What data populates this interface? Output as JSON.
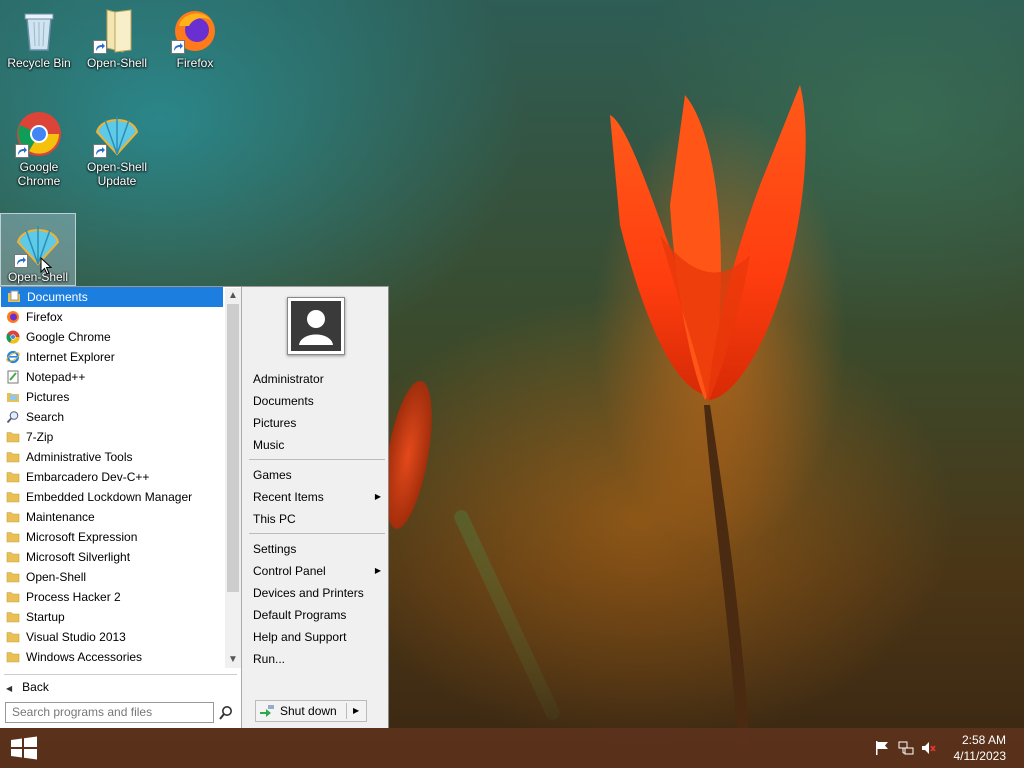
{
  "desktop": {
    "icons": [
      {
        "label": "Recycle Bin"
      },
      {
        "label": "Open-Shell"
      },
      {
        "label": "Firefox"
      },
      {
        "label": "Google Chrome"
      },
      {
        "label": "Open-Shell Update"
      },
      {
        "label": "Open-Shell"
      }
    ]
  },
  "start_menu": {
    "programs": [
      {
        "label": "Documents",
        "icon": "documents-icon",
        "selected": true
      },
      {
        "label": "Firefox",
        "icon": "firefox-icon"
      },
      {
        "label": "Google Chrome",
        "icon": "chrome-icon"
      },
      {
        "label": "Internet Explorer",
        "icon": "internet-explorer-icon"
      },
      {
        "label": "Notepad++",
        "icon": "notepad-icon"
      },
      {
        "label": "Pictures",
        "icon": "pictures-icon"
      },
      {
        "label": "Search",
        "icon": "search-icon"
      },
      {
        "label": "7-Zip",
        "icon": "folder-icon"
      },
      {
        "label": "Administrative Tools",
        "icon": "folder-icon"
      },
      {
        "label": "Embarcadero Dev-C++",
        "icon": "folder-icon"
      },
      {
        "label": "Embedded Lockdown Manager",
        "icon": "folder-icon"
      },
      {
        "label": "Maintenance",
        "icon": "folder-icon"
      },
      {
        "label": "Microsoft Expression",
        "icon": "folder-icon"
      },
      {
        "label": "Microsoft Silverlight",
        "icon": "folder-icon"
      },
      {
        "label": "Open-Shell",
        "icon": "folder-icon"
      },
      {
        "label": "Process Hacker 2",
        "icon": "folder-icon"
      },
      {
        "label": "Startup",
        "icon": "folder-icon"
      },
      {
        "label": "Visual Studio 2013",
        "icon": "folder-icon"
      },
      {
        "label": "Windows Accessories",
        "icon": "folder-icon"
      }
    ],
    "back_label": "Back",
    "search_placeholder": "Search programs and files",
    "right": {
      "items": [
        {
          "label": "Administrator"
        },
        {
          "label": "Documents"
        },
        {
          "label": "Pictures"
        },
        {
          "label": "Music"
        },
        {
          "label": "Games"
        },
        {
          "label": "Recent Items",
          "submenu": true
        },
        {
          "label": "This PC"
        },
        {
          "label": "Settings"
        },
        {
          "label": "Control Panel",
          "submenu": true
        },
        {
          "label": "Devices and Printers"
        },
        {
          "label": "Default Programs"
        },
        {
          "label": "Help and Support"
        },
        {
          "label": "Run..."
        }
      ],
      "shutdown_label": "Shut down"
    }
  },
  "taskbar": {
    "time": "2:58 AM",
    "date": "4/11/2023",
    "tray_icons": [
      "flag-icon",
      "network-icon",
      "volume-muted-icon"
    ]
  },
  "colors": {
    "selection": "#1c7fe0",
    "taskbar": "#5c321c",
    "folder": "#e8c055"
  }
}
